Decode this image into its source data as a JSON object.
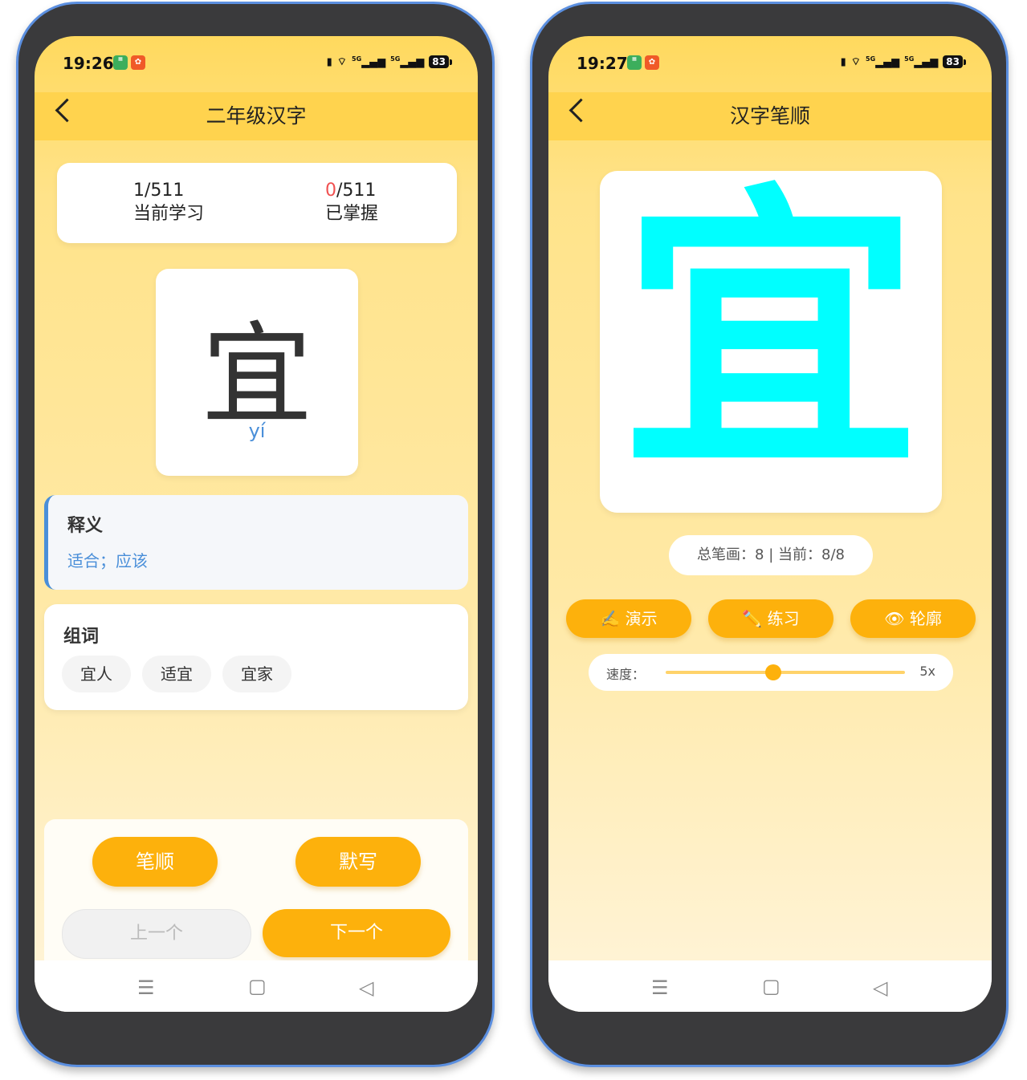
{
  "left": {
    "status": {
      "time": "19:26",
      "battery": "83",
      "network1": "5G",
      "network2": "5G"
    },
    "header": {
      "title": "二年级汉字"
    },
    "progress": {
      "current_value": "1/511",
      "current_label": "当前学习",
      "mastered_count": "0",
      "mastered_total": "/511",
      "mastered_label": "已掌握"
    },
    "character": {
      "glyph": "宜",
      "pinyin": "yí"
    },
    "meaning": {
      "heading": "释义",
      "text": "适合；应该"
    },
    "words": {
      "heading": "组词",
      "items": [
        "宜人",
        "适宜",
        "宜家"
      ]
    },
    "buttons": {
      "stroke_order": "笔顺",
      "dictation": "默写",
      "prev": "上一个",
      "next": "下一个"
    }
  },
  "right": {
    "status": {
      "time": "19:27",
      "battery": "83",
      "network1": "5G",
      "network2": "5G"
    },
    "header": {
      "title": "汉字笔顺"
    },
    "character": {
      "glyph": "宜",
      "color": "#00ffff"
    },
    "stroke_info": "总笔画：8 | 当前：8/8",
    "buttons": {
      "demo": "✍️ 演示",
      "practice": "✏️ 练习",
      "outline": "👁 轮廓"
    },
    "speed": {
      "label": "速度：",
      "value": "5x",
      "level_fraction": 0.45
    }
  },
  "colors": {
    "accent": "#fdb10c",
    "header": "#ffd34e",
    "mastered_red": "#f05050",
    "pinyin_blue": "#4a8fd9"
  }
}
